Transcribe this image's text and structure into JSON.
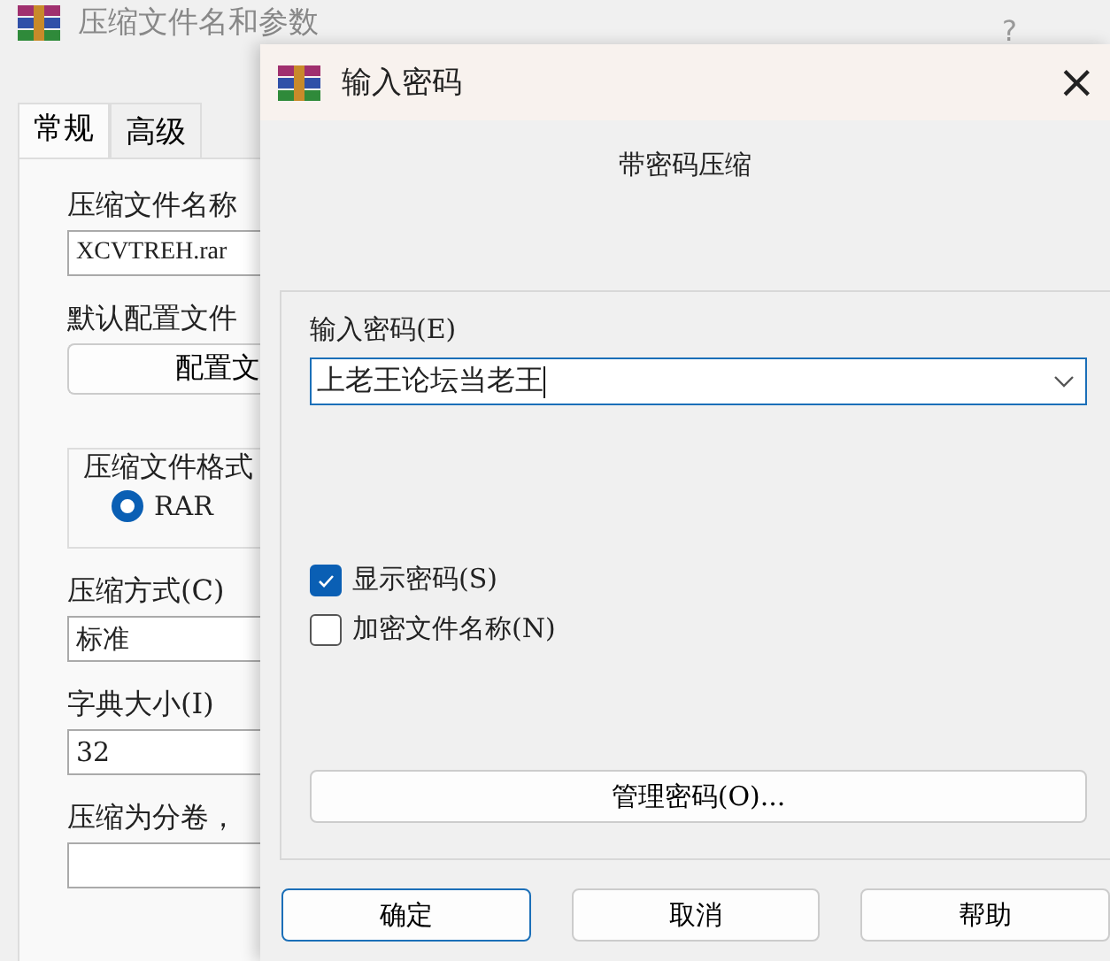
{
  "back_window": {
    "title": "压缩文件名和参数",
    "help": "?",
    "tabs": [
      {
        "label": "常规",
        "selected": true
      },
      {
        "label": "高级",
        "selected": false
      }
    ],
    "archive_name": {
      "label": "压缩文件名称",
      "value": "XCVTREH.rar"
    },
    "profile": {
      "label": "默认配置文件",
      "button": "配置文"
    },
    "format": {
      "label": "压缩文件格式",
      "options": [
        {
          "label": "RAR",
          "selected": true
        }
      ]
    },
    "method": {
      "label": "压缩方式(C)",
      "value": "标准"
    },
    "dictionary": {
      "label": "字典大小(I)",
      "value": "32"
    },
    "volumes": {
      "label": "压缩为分卷，"
    }
  },
  "dialog": {
    "title": "输入密码",
    "close": "×",
    "heading": "带密码压缩",
    "password": {
      "label": "输入密码(E)",
      "value": "上老王论坛当老王"
    },
    "options": [
      {
        "label": "显示密码(S)",
        "checked": true
      },
      {
        "label": "加密文件名称(N)",
        "checked": false
      }
    ],
    "manage_button": "管理密码(O)...",
    "buttons": [
      {
        "label": "确定",
        "default": true
      },
      {
        "label": "取消",
        "default": false
      },
      {
        "label": "帮助",
        "default": false
      }
    ]
  }
}
